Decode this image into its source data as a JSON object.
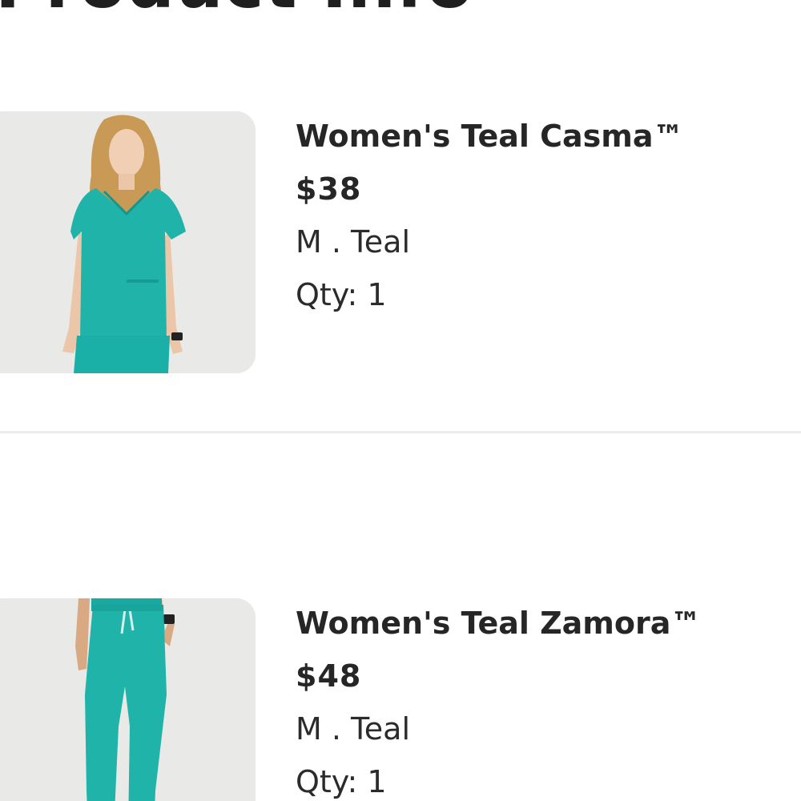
{
  "section": {
    "title": "Product Info"
  },
  "colors": {
    "accent": "#1fb3aa",
    "text": "#262626",
    "thumb_bg": "#e8e8e6"
  },
  "items": [
    {
      "name": "Women's Teal Casma™",
      "price": "$38",
      "variant": "M . Teal",
      "qty": "Qty: 1",
      "image": "teal-scrub-top-photo"
    },
    {
      "name": "Women's Teal Zamora™",
      "price": "$48",
      "variant": "M . Teal",
      "qty": "Qty: 1",
      "image": "teal-jogger-pants-photo"
    }
  ]
}
